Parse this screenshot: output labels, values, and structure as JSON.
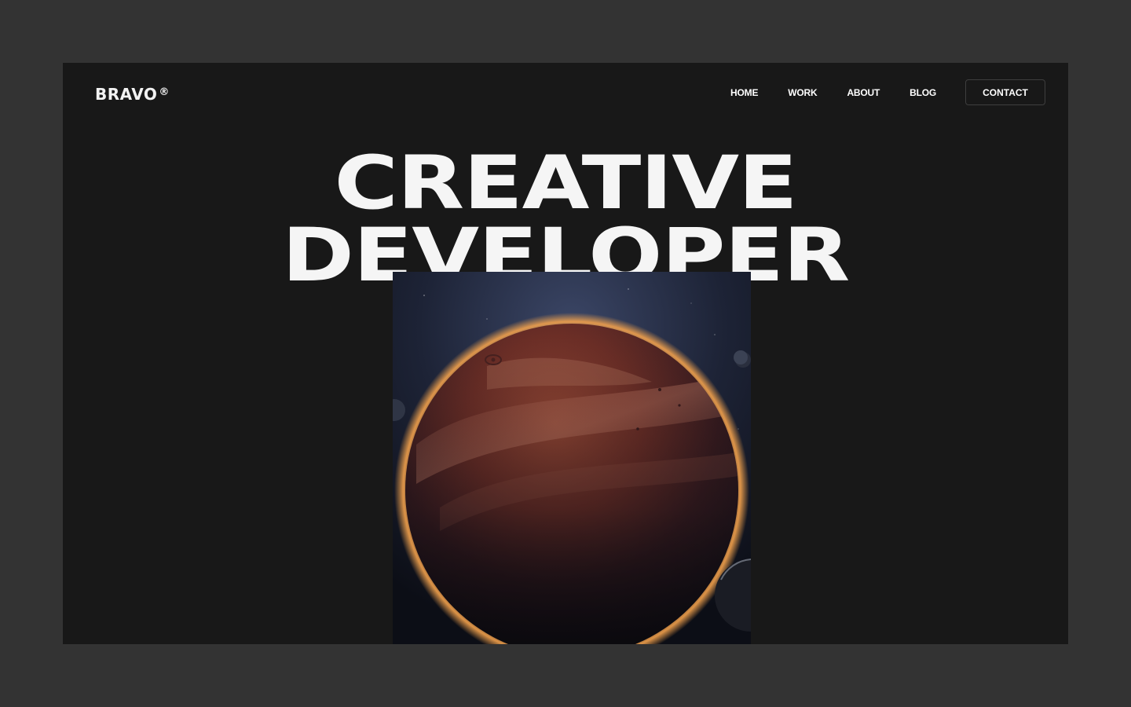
{
  "header": {
    "logo_text": "BRAVO",
    "logo_mark": "®",
    "nav": [
      {
        "label": "HOME"
      },
      {
        "label": "WORK"
      },
      {
        "label": "ABOUT"
      },
      {
        "label": "BLOG"
      }
    ],
    "contact_label": "CONTACT"
  },
  "hero": {
    "line1": "CREATIVE",
    "line2": "DEVELOPER"
  },
  "image": {
    "subject": "planet-illustration"
  },
  "colors": {
    "page_bg": "#333333",
    "frame_bg": "#181818",
    "text": "#f5f5f5",
    "planet_glow": "#f0a04a"
  }
}
